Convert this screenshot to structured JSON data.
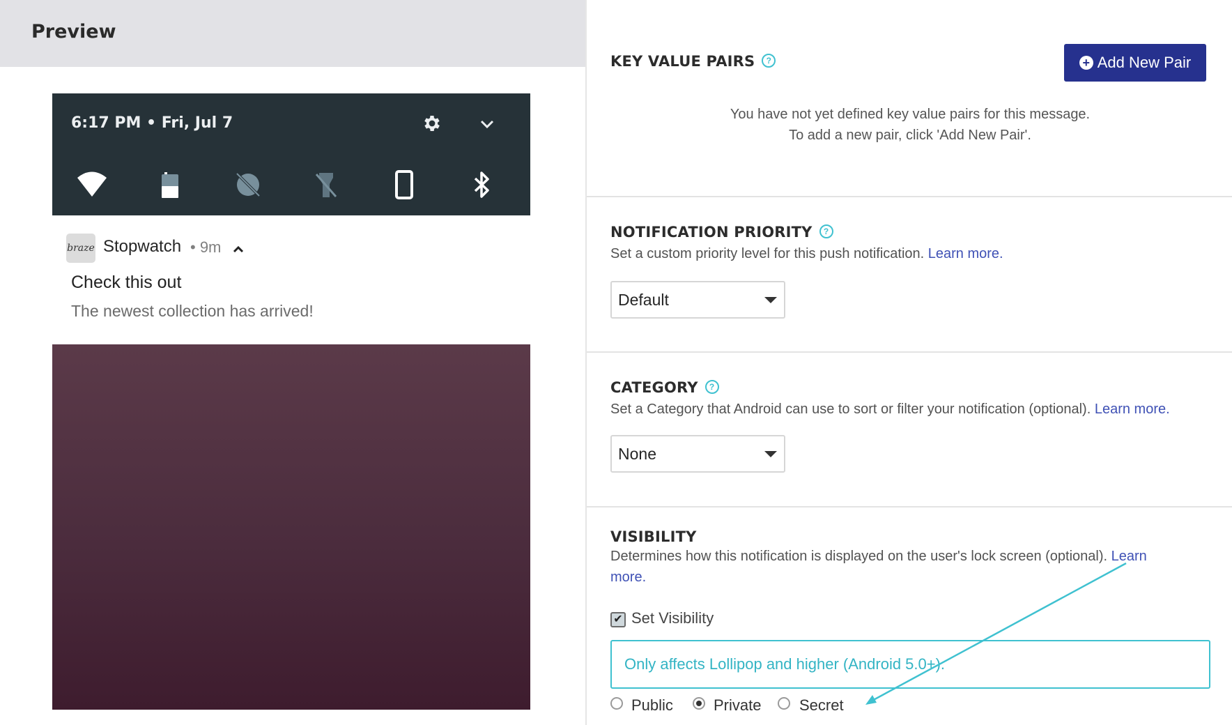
{
  "preview": {
    "title": "Preview",
    "shade": {
      "time": "6:17 PM • Fri, Jul 7",
      "quick_settings": [
        "wifi-icon",
        "battery-icon",
        "data-saver-off-icon",
        "flashlight-off-icon",
        "screen-rotation-icon",
        "bluetooth-icon"
      ]
    },
    "notification": {
      "app_icon_text": "braze",
      "app_name": "Stopwatch",
      "time": "• 9m",
      "title": "Check this out",
      "body": "The newest collection has arrived!"
    }
  },
  "key_value_pairs": {
    "title": "KEY VALUE PAIRS",
    "help": "?",
    "add_button": "Add New Pair",
    "empty_line1": "You have not yet defined key value pairs for this message.",
    "empty_line2": "To add a new pair, click 'Add New Pair'."
  },
  "notification_priority": {
    "title": "NOTIFICATION PRIORITY",
    "help": "?",
    "description": "Set a custom priority level for this push notification.",
    "learn_more": "Learn more.",
    "selected": "Default"
  },
  "category": {
    "title": "CATEGORY",
    "help": "?",
    "description": "Set a Category that Android can use to sort or filter your notification (optional).",
    "learn_more": "Learn more.",
    "selected": "None"
  },
  "visibility": {
    "title": "VISIBILITY",
    "description": "Determines how this notification is displayed on the user's lock screen (optional).",
    "learn_more_1": "Learn",
    "learn_more_2": "more.",
    "checkbox_label": "Set Visibility",
    "checkbox_checked": true,
    "info": "Only affects Lollipop and higher (Android 5.0+).",
    "options": [
      "Public",
      "Private",
      "Secret"
    ],
    "selected": "Private"
  },
  "colors": {
    "shade": "#263238",
    "accent_teal": "#3fc1d0",
    "button_navy": "#26318e",
    "link": "#3f51b5"
  }
}
